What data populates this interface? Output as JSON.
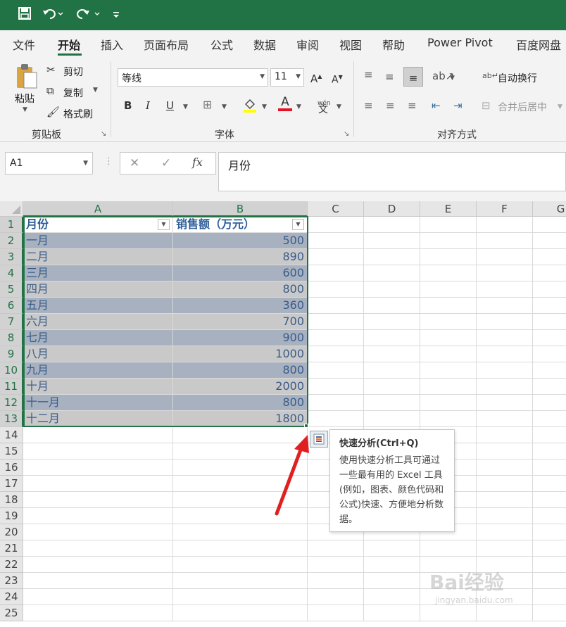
{
  "colors": {
    "accent": "#217346",
    "table_dark": "#a7b1bf",
    "table_light": "#c9c9c9",
    "header_text": "#2e5e98",
    "arrow": "#e02020"
  },
  "quick_access": {
    "save_icon": "save-icon",
    "undo_icon": "undo-icon",
    "redo_icon": "redo-icon",
    "customize_icon": "customize-icon"
  },
  "tabs": [
    "文件",
    "开始",
    "插入",
    "页面布局",
    "公式",
    "数据",
    "审阅",
    "视图",
    "帮助",
    "Power Pivot",
    "百度网盘"
  ],
  "active_tab": "开始",
  "clipboard": {
    "paste": "粘贴",
    "cut": "剪切",
    "copy": "复制",
    "format_painter": "格式刷",
    "label": "剪贴板"
  },
  "font": {
    "name": "等线",
    "size": "11",
    "label": "字体",
    "bold": "B",
    "italic": "I",
    "underline": "U",
    "font_color_letter": "A",
    "phonetic": "wén"
  },
  "alignment": {
    "wrap": "自动换行",
    "merge": "合并后居中",
    "label": "对齐方式"
  },
  "namebox": "A1",
  "formula_value": "月份",
  "fx": "fx",
  "columns": [
    "A",
    "B",
    "C",
    "D",
    "E",
    "F",
    "G"
  ],
  "rows": [
    "1",
    "2",
    "3",
    "4",
    "5",
    "6",
    "7",
    "8",
    "9",
    "10",
    "11",
    "12",
    "13",
    "14",
    "15",
    "16",
    "17",
    "18",
    "19",
    "20",
    "21",
    "22",
    "23",
    "24",
    "25"
  ],
  "table": {
    "headers": [
      "月份",
      "销售额（万元）"
    ],
    "rows": [
      [
        "一月",
        "500"
      ],
      [
        "二月",
        "890"
      ],
      [
        "三月",
        "600"
      ],
      [
        "四月",
        "800"
      ],
      [
        "五月",
        "360"
      ],
      [
        "六月",
        "700"
      ],
      [
        "七月",
        "900"
      ],
      [
        "八月",
        "1000"
      ],
      [
        "九月",
        "800"
      ],
      [
        "十月",
        "2000"
      ],
      [
        "十一月",
        "800"
      ],
      [
        "十二月",
        "1800"
      ]
    ]
  },
  "tooltip": {
    "title": "快速分析(Ctrl+Q)",
    "body": "使用快速分析工具可通过一些最有用的 Excel 工具(例如，图表、颜色代码和公式)快速、方便地分析数据。"
  },
  "watermark": "Bai经验",
  "watermark_url": "jingyan.baidu.com"
}
